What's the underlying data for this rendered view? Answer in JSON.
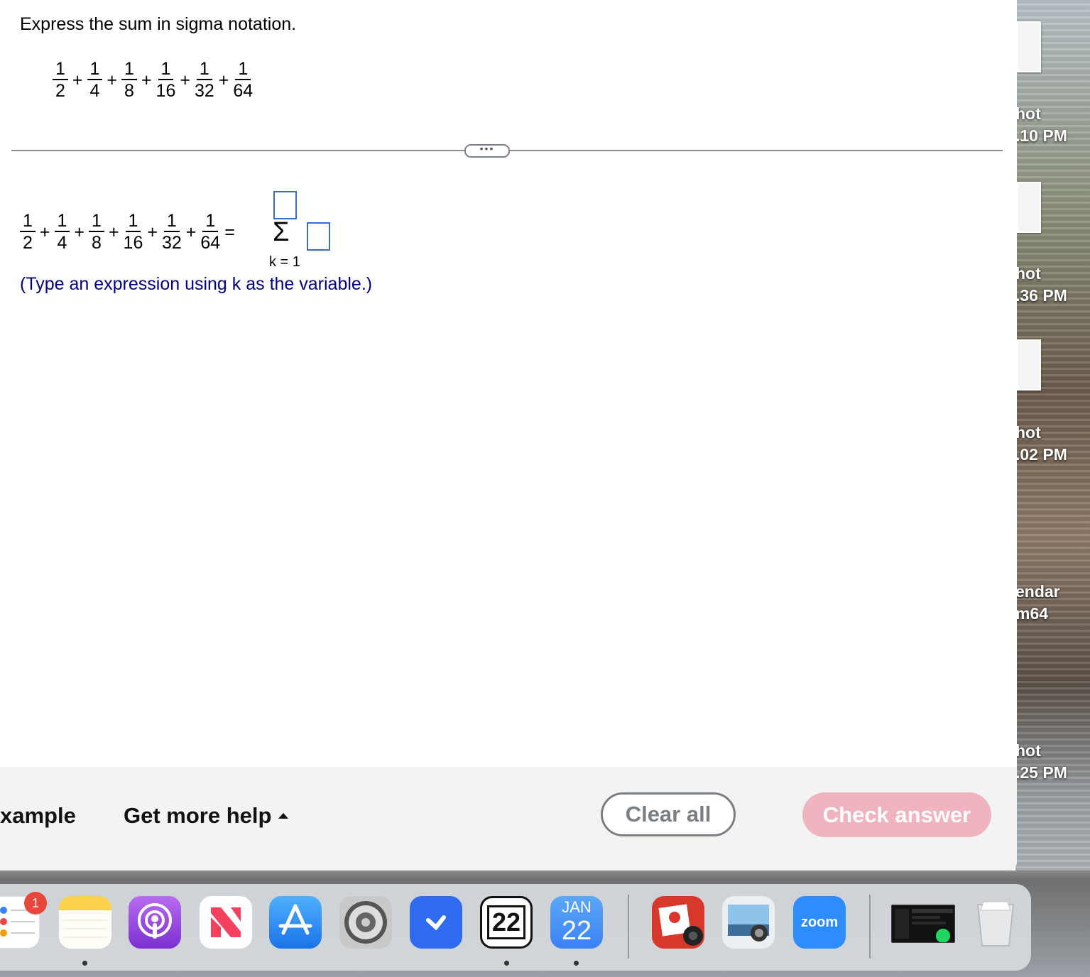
{
  "question": {
    "title": "Express the sum in sigma notation.",
    "fractions": [
      {
        "num": "1",
        "den": "2"
      },
      {
        "num": "1",
        "den": "4"
      },
      {
        "num": "1",
        "den": "8"
      },
      {
        "num": "1",
        "den": "16"
      },
      {
        "num": "1",
        "den": "32"
      },
      {
        "num": "1",
        "den": "64"
      }
    ],
    "plus": "+",
    "equals": "="
  },
  "answer": {
    "sigma": "Σ",
    "lower_limit": "k = 1",
    "upper_limit_value": "",
    "expression_value": "",
    "instruction": "(Type an expression using k as the variable.)"
  },
  "divider": {
    "handle": "•••"
  },
  "footer": {
    "example": "xample",
    "more_help": "Get more help",
    "clear": "Clear all",
    "check": "Check answer"
  },
  "desktop": {
    "labels": [
      "hot",
      ".10 PM",
      "hot",
      ".36 PM",
      "hot",
      ".02 PM",
      "endar",
      "m64",
      "hot",
      ".25 PM"
    ]
  },
  "dock": {
    "reminders_badge": "1",
    "calendar_month": "JAN",
    "calendar_day": "22",
    "dark_calendar_day": "22",
    "zoom_label": "zoom",
    "icons": [
      "reminders-icon",
      "notes-icon",
      "podcasts-icon",
      "news-icon",
      "app-store-icon",
      "system-settings-icon",
      "testflight-icon",
      "dark-calendar-icon",
      "calendar-icon",
      "photo-booth-icon",
      "preview-icon",
      "zoom-icon",
      "spotify-window-icon",
      "trash-icon"
    ]
  },
  "colors": {
    "accent_blue": "#3a6fc4",
    "instruction_text": "#00007d",
    "check_button": "#f0b3c0",
    "clear_border": "#7a7f86"
  }
}
